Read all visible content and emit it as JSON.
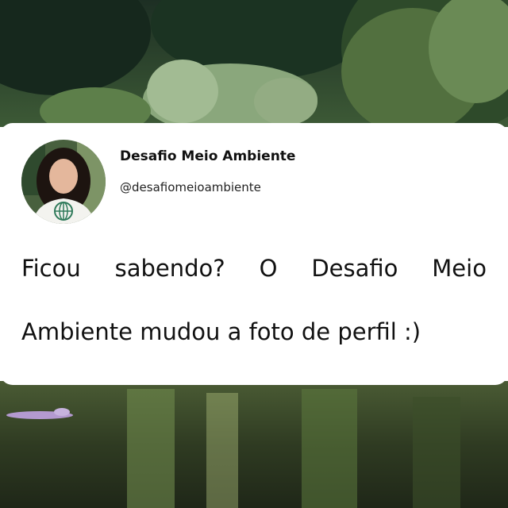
{
  "profile": {
    "display_name": "Desafio Meio Ambiente",
    "handle": "@desafiomeioambiente"
  },
  "post": {
    "line1_words": [
      "Ficou",
      "sabendo?",
      "O",
      "Desafio",
      "Meio"
    ],
    "line2": "Ambiente mudou a foto de perfil :)"
  }
}
